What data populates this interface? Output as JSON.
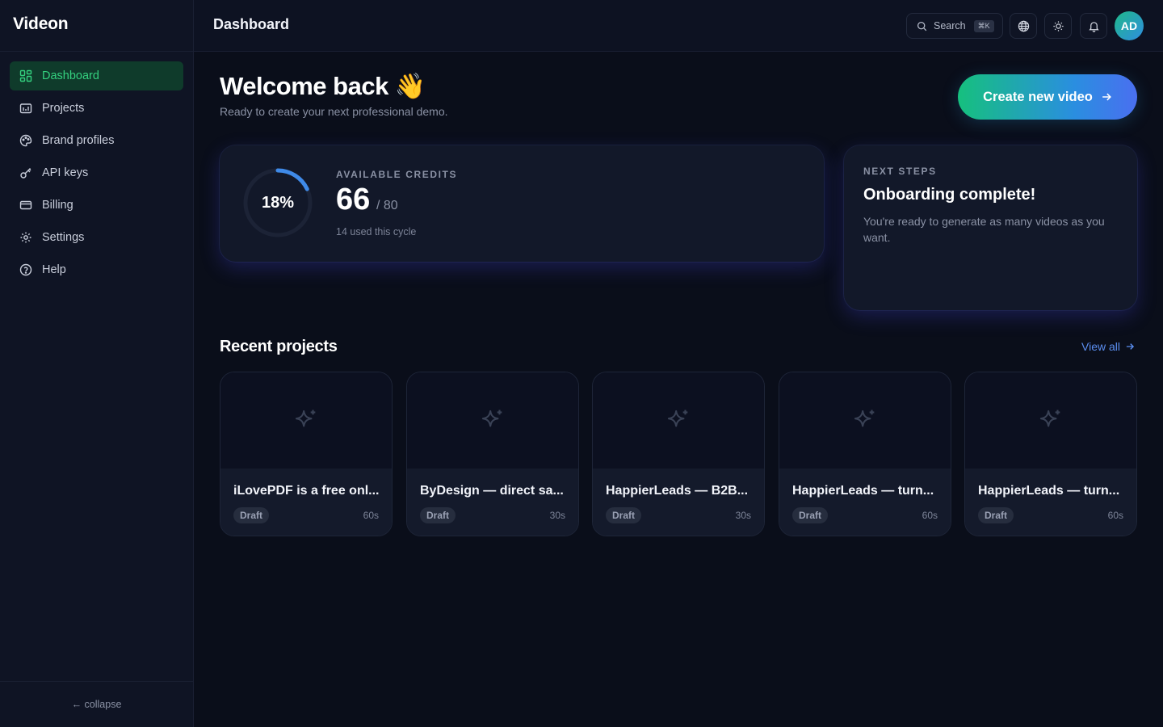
{
  "app": {
    "name": "Videon"
  },
  "sidebar": {
    "items": [
      {
        "label": "Dashboard",
        "icon": "dashboard-icon",
        "active": true
      },
      {
        "label": "Projects",
        "icon": "projects-icon",
        "active": false
      },
      {
        "label": "Brand profiles",
        "icon": "palette-icon",
        "active": false
      },
      {
        "label": "API keys",
        "icon": "key-icon",
        "active": false
      },
      {
        "label": "Billing",
        "icon": "credit-card-icon",
        "active": false
      },
      {
        "label": "Settings",
        "icon": "gear-icon",
        "active": false
      },
      {
        "label": "Help",
        "icon": "help-icon",
        "active": false
      }
    ],
    "collapse_label": "← collapse"
  },
  "header": {
    "title": "Dashboard",
    "search_label": "Search",
    "search_shortcut": "⌘K",
    "avatar_initials": "AD"
  },
  "welcome": {
    "title": "Welcome back 👋",
    "subtitle": "Ready to create your next professional demo.",
    "cta_label": "Create new video"
  },
  "credits": {
    "label": "AVAILABLE CREDITS",
    "percent_label": "18%",
    "percent_used": 0.18,
    "available": "66",
    "total": "/ 80",
    "used_text": "14 used this cycle"
  },
  "next_steps": {
    "label": "NEXT STEPS",
    "title": "Onboarding complete!",
    "description": "You're ready to generate as many videos as you want."
  },
  "recent": {
    "title": "Recent projects",
    "view_all_label": "View all",
    "projects": [
      {
        "title": "iLovePDF is a free onl...",
        "status": "Draft",
        "duration": "60s"
      },
      {
        "title": "ByDesign — direct sa...",
        "status": "Draft",
        "duration": "30s"
      },
      {
        "title": "HappierLeads — B2B...",
        "status": "Draft",
        "duration": "30s"
      },
      {
        "title": "HappierLeads — turn...",
        "status": "Draft",
        "duration": "60s"
      },
      {
        "title": "HappierLeads — turn...",
        "status": "Draft",
        "duration": "60s"
      }
    ]
  },
  "colors": {
    "accent_green": "#34d17f",
    "accent_blue": "#3f8ae8",
    "background": "#0a0e1a"
  }
}
